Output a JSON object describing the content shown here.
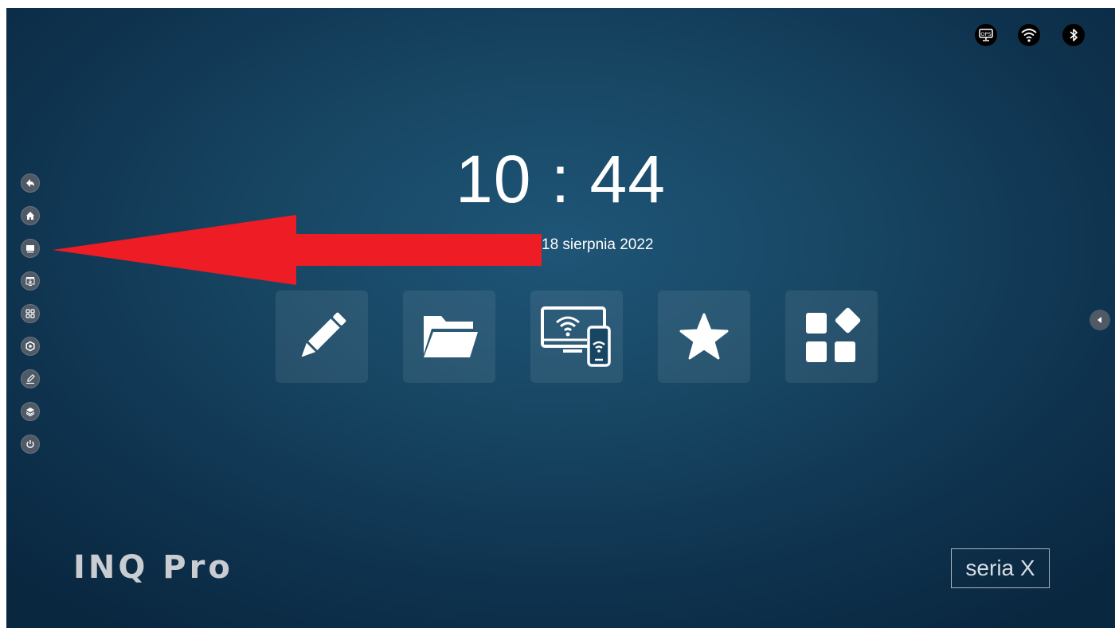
{
  "status_bar": {
    "icons": [
      "ops-icon",
      "wifi-icon",
      "bluetooth-icon"
    ],
    "ops_label": "OPS"
  },
  "sidebar": {
    "items": [
      {
        "name": "back",
        "icon": "back-icon"
      },
      {
        "name": "home",
        "icon": "home-icon"
      },
      {
        "name": "display",
        "icon": "monitor-icon"
      },
      {
        "name": "screen-share",
        "icon": "screen-download-icon"
      },
      {
        "name": "apps",
        "icon": "apps-grid-icon"
      },
      {
        "name": "settings",
        "icon": "settings-icon"
      },
      {
        "name": "annotate",
        "icon": "pen-icon"
      },
      {
        "name": "layers",
        "icon": "layers-icon"
      },
      {
        "name": "power",
        "icon": "power-icon"
      }
    ]
  },
  "clock": {
    "time": "10 : 44"
  },
  "date": {
    "text": "18 sierpnia 2022"
  },
  "tiles": [
    {
      "name": "whiteboard",
      "icon": "pencil-icon"
    },
    {
      "name": "files",
      "icon": "folder-icon"
    },
    {
      "name": "screen-mirroring",
      "icon": "wireless-display-icon"
    },
    {
      "name": "favorites",
      "icon": "star-icon"
    },
    {
      "name": "applications",
      "icon": "apps-icon"
    }
  ],
  "annotation": {
    "arrow_color": "#ee1c25"
  },
  "branding": {
    "logo": "INQ Pro",
    "series": "seria X"
  },
  "colors": {
    "background": "#174663",
    "tile": "rgba(255,255,255,0.08)",
    "sidebar_button": "#4f5a66"
  }
}
